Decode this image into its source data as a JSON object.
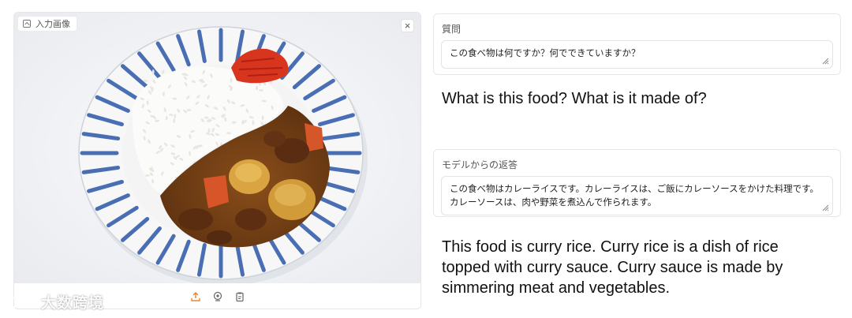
{
  "image_panel": {
    "label": "入力画像",
    "close_symbol": "×",
    "image_description": "",
    "toolbar": {
      "icons": [
        "upload-icon",
        "webcam-icon",
        "clipboard-icon"
      ]
    }
  },
  "question_field": {
    "label": "質問",
    "value": "この食べ物は何ですか？何でできていますか？"
  },
  "question_translation": "What is this food? What is it made of?",
  "answer_field": {
    "label": "モデルからの返答",
    "value": "この食べ物はカレーライスです。カレーライスは、ご飯にカレーソースをかけた料理です。カレーソースは、肉や野菜を煮込んで作られます。"
  },
  "answer_translation": "This food is curry rice. Curry rice is a dish of rice topped with curry sauce. Curry sauce is made by simmering meat and vegetables.",
  "watermark": {
    "text": "大数跨境"
  },
  "colors": {
    "accent": "#e8862e",
    "plate_blue": "#2b57a8",
    "curry": "#7a4415"
  }
}
